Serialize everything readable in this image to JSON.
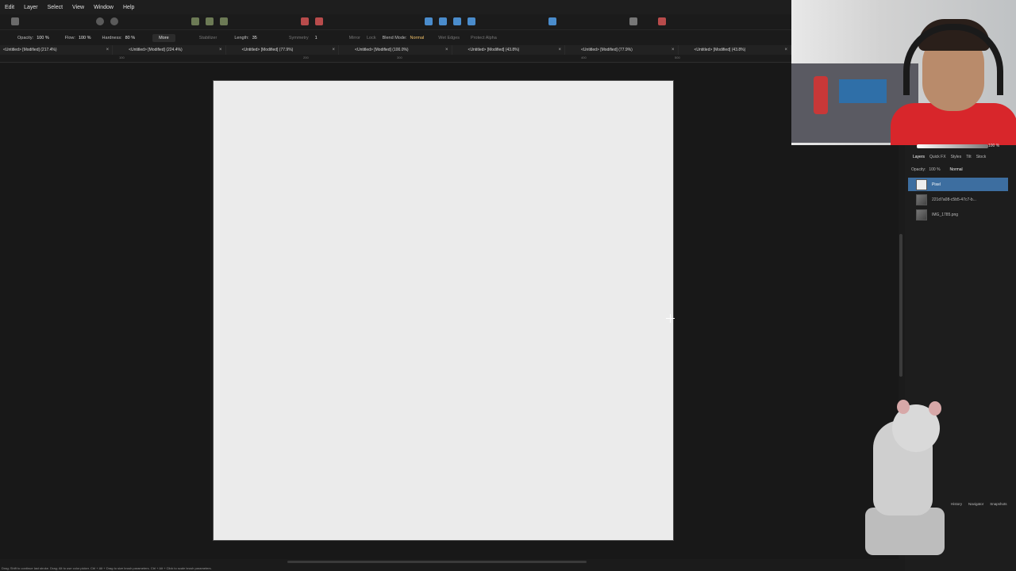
{
  "menu": [
    "Edit",
    "Layer",
    "Select",
    "View",
    "Window",
    "Help"
  ],
  "context": {
    "opacity_label": "Opacity:",
    "opacity": "100 %",
    "flow_label": "Flow:",
    "flow": "100 %",
    "hardness_label": "Hardness:",
    "hardness": "80 %",
    "more": "More",
    "stabilizer": "Stabilizer",
    "length_label": "Length:",
    "length": "35",
    "symmetry": "Symmetry",
    "symmetry_count": "1",
    "mirror": "Mirror",
    "lock": "Lock",
    "blend_label": "Blend Mode:",
    "blend": "Normal",
    "wet_edges": "Wet Edges",
    "protect_alpha": "Protect Alpha"
  },
  "tabs": [
    "<Untitled> [Modified] (217.4%)",
    "<Untitled> [Modified] (224.4%)",
    "<Untitled> [Modified] (77.9%)",
    "<Untitled> [Modified] (100.0%)",
    "<Untitled> [Modified] (43.8%)",
    "<Untitled> [Modified] (77.9%)",
    "<Untitled> [Modified] (43.8%)"
  ],
  "ruler": [
    "100",
    "200",
    "300",
    "400",
    "500"
  ],
  "panel": {
    "zoom": "100 %",
    "tabs": [
      "Layers",
      "Quick FX",
      "Styles",
      "Tilt",
      "Stock"
    ],
    "opacity_label": "Opacity:",
    "opacity": "100 %",
    "blend": "Normal",
    "layers": [
      {
        "name": "Pixel",
        "selected": true
      },
      {
        "name": "221d7a08-c5b5-47c7-b...",
        "selected": false
      },
      {
        "name": "IMG_1785.png",
        "selected": false
      }
    ],
    "bottom_tabs": [
      "History",
      "Navigator",
      "Snapshots"
    ]
  },
  "status": "Drag; Shift to continue last stroke. Drag; Alt to use color picker. Ctrl + Alt + Drag to size brush parameters. Ctrl + Alt + Click to scale brush parameters."
}
